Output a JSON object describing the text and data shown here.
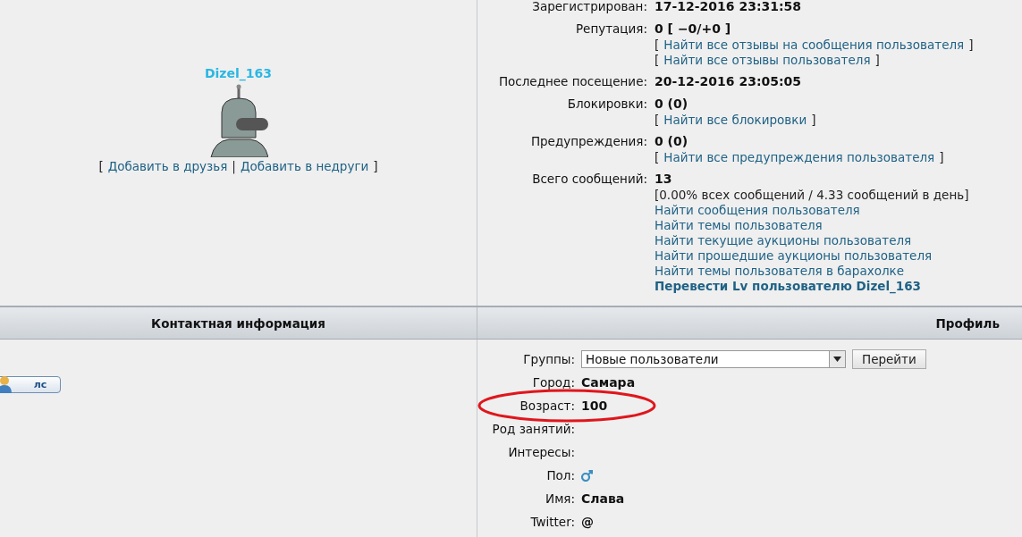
{
  "user_card": {
    "username": "Dizel_163",
    "actions": {
      "open": "[",
      "links": [
        "Добавить в друзья",
        "Добавить в недруги"
      ],
      "separator": "|",
      "close": "]"
    }
  },
  "stats": [
    {
      "label": "Зарегистрирован:",
      "value": "17-12-2016 23:31:58"
    },
    {
      "label": "Репутация:",
      "value": "0 [ −0/+0 ]",
      "lines": [
        {
          "kind": "bracketed",
          "open": "[",
          "text": "Найти все отзывы на сообщения пользователя",
          "close": "]"
        },
        {
          "kind": "bracketed",
          "open": "[",
          "text": "Найти все отзывы пользователя",
          "close": "]"
        }
      ]
    },
    {
      "label": "Последнее посещение:",
      "value": "20-12-2016 23:05:05"
    },
    {
      "label": "Блокировки:",
      "value": "0 (0)",
      "lines": [
        {
          "kind": "bracketed",
          "open": "[",
          "text": "Найти все блокировки",
          "close": "]"
        }
      ]
    },
    {
      "label": "Предупреждения:",
      "value": "0 (0)",
      "lines": [
        {
          "kind": "bracketed",
          "open": "[",
          "text": "Найти все предупреждения пользователя",
          "close": "]"
        }
      ]
    },
    {
      "label": "Всего сообщений:",
      "value": "13",
      "lines": [
        {
          "kind": "text",
          "text": "[0.00% всех сообщений / 4.33 сообщений в день]"
        },
        {
          "kind": "link",
          "text": "Найти сообщения пользователя"
        },
        {
          "kind": "link",
          "text": "Найти темы пользователя"
        },
        {
          "kind": "link",
          "text": "Найти текущие аукционы пользователя"
        },
        {
          "kind": "link",
          "text": "Найти прошедшие аукционы пользователя"
        },
        {
          "kind": "link",
          "text": "Найти темы пользователя в барахолке"
        },
        {
          "kind": "bold-link",
          "text": "Перевести Lv пользователю Dizel_163"
        }
      ]
    }
  ],
  "headers": {
    "contact": "Контактная информация",
    "profile": "Профиль"
  },
  "contact": {
    "pm_button": "лс"
  },
  "profile": [
    {
      "kind": "select",
      "label": "Группы:",
      "value": "Новые пользователи",
      "button": "Перейти"
    },
    {
      "kind": "text",
      "label": "Город:",
      "value": "Самара"
    },
    {
      "kind": "text",
      "label": "Возраст:",
      "value": "100",
      "circled": true
    },
    {
      "kind": "empty",
      "label": "Род занятий:"
    },
    {
      "kind": "empty",
      "label": "Интересы:"
    },
    {
      "kind": "gender",
      "label": "Пол:"
    },
    {
      "kind": "text",
      "label": "Имя:",
      "value": "Слава"
    },
    {
      "kind": "text",
      "label": "Twitter:",
      "value": "@"
    }
  ]
}
